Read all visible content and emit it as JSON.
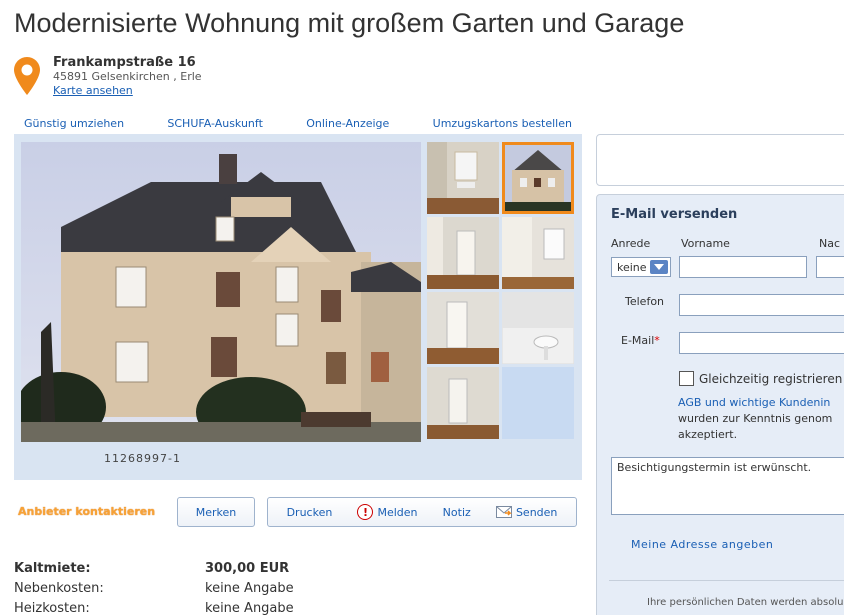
{
  "header": {
    "title": "Modernisierte Wohnung mit großem Garten und Garage"
  },
  "address": {
    "street": "Frankampstraße 16",
    "city": "45891 Gelsenkirchen , Erle",
    "map_link": "Karte ansehen",
    "pin_color": "#f08a1c"
  },
  "top_links": [
    "Günstig umziehen",
    "SCHUFA-Auskunft",
    "Online-Anzeige",
    "Umzugskartons bestellen"
  ],
  "gallery": {
    "listing_id": "11268997-1",
    "thumbnail_count": 8,
    "active_thumbnail": 2
  },
  "actions": {
    "contact_activate": "Anbieter kontaktieren",
    "remember": "Merken",
    "print": "Drucken",
    "report": "Melden",
    "note": "Notiz",
    "send": "Senden"
  },
  "costs": [
    {
      "label": "Kaltmiete:",
      "value": "300,00 EUR"
    },
    {
      "label": "Nebenkosten:",
      "value": "keine Angabe"
    },
    {
      "label": "Heizkosten:",
      "value": "keine Angabe"
    }
  ],
  "email_form": {
    "title": "E-Mail versenden",
    "salutation_label": "Anrede",
    "salutation_value": "keine",
    "firstname_label": "Vorname",
    "lastname_label": "Nac",
    "phone_label": "Telefon",
    "email_label": "E-Mail",
    "email_required": "*",
    "register_label": "Gleichzeitig registrieren",
    "agb_link": "AGB und wichtige Kundenin",
    "agb_line2": "wurden zur Kenntnis genom",
    "agb_line3": "akzeptiert.",
    "message": "Besichtigungstermin ist erwünscht.",
    "own_address_link": "Meine Adresse angeben",
    "privacy_note": "Ihre persönlichen Daten werden absolu"
  },
  "colors": {
    "accent": "#1a5fb4",
    "panel_bg": "#e6edf7",
    "gallery_bg": "#d9e4f2",
    "contact_orange": "#f7a236"
  }
}
